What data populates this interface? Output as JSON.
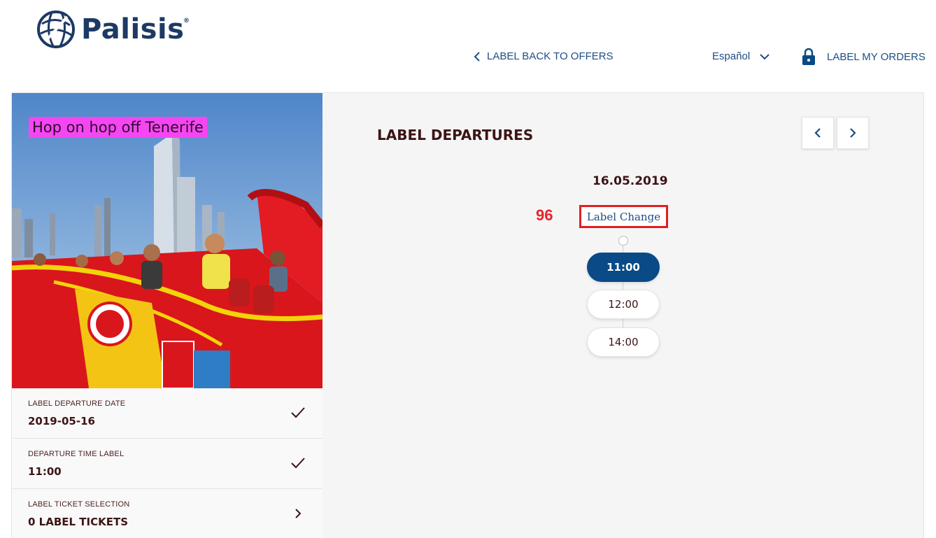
{
  "header": {
    "brand": "Palisis",
    "brand_mark": "®",
    "back_label": "LABEL BACK TO OFFERS",
    "language": "Español",
    "orders_label": "LABEL MY ORDERS"
  },
  "product": {
    "title": "Hop on hop off Tenerife"
  },
  "summary": [
    {
      "label": "LABEL DEPARTURE DATE",
      "value": "2019-05-16",
      "icon": "check-icon"
    },
    {
      "label": "DEPARTURE TIME LABEL",
      "value": "11:00",
      "icon": "check-icon"
    },
    {
      "label": "LABEL TICKET SELECTION",
      "value": "0 LABEL TICKETS",
      "icon": "chevron-right-icon"
    }
  ],
  "departures": {
    "title": "LABEL DEPARTURES",
    "date": "16.05.2019",
    "count": "96",
    "change_label": "Label Change",
    "slots": [
      "11:00",
      "12:00",
      "14:00"
    ],
    "selected_slot": "11:00"
  },
  "colors": {
    "brand_blue": "#1d4e86",
    "active_slot": "#0a4a86",
    "title_highlight": "#f646f2",
    "alert_red": "#e8232a"
  }
}
